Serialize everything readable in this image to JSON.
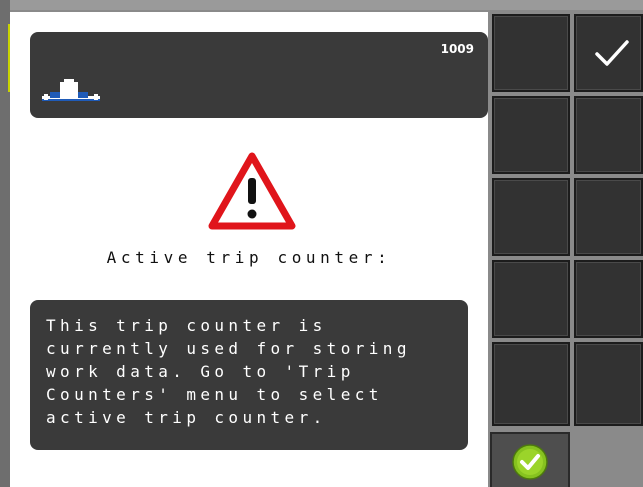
{
  "header": {
    "alarm_code": "1009",
    "icon": "sprayer-icon"
  },
  "alarm": {
    "icon": "warning-triangle-icon",
    "title": "Active trip counter:",
    "message_lines": [
      "This trip counter is",
      "currently used for storing",
      "work data. Go to 'Trip",
      "Counters' menu to select",
      "active trip counter."
    ]
  },
  "softkeys": {
    "top_right_icon": "checkmark-icon",
    "bottom_icon": "confirm-circle-icon"
  },
  "colors": {
    "background": "#8a8a8a",
    "dark_box": "#3a3a3a",
    "warning_red": "#e0151b",
    "confirm_green": "#86c21f",
    "accent_yellow": "#c9d400"
  }
}
